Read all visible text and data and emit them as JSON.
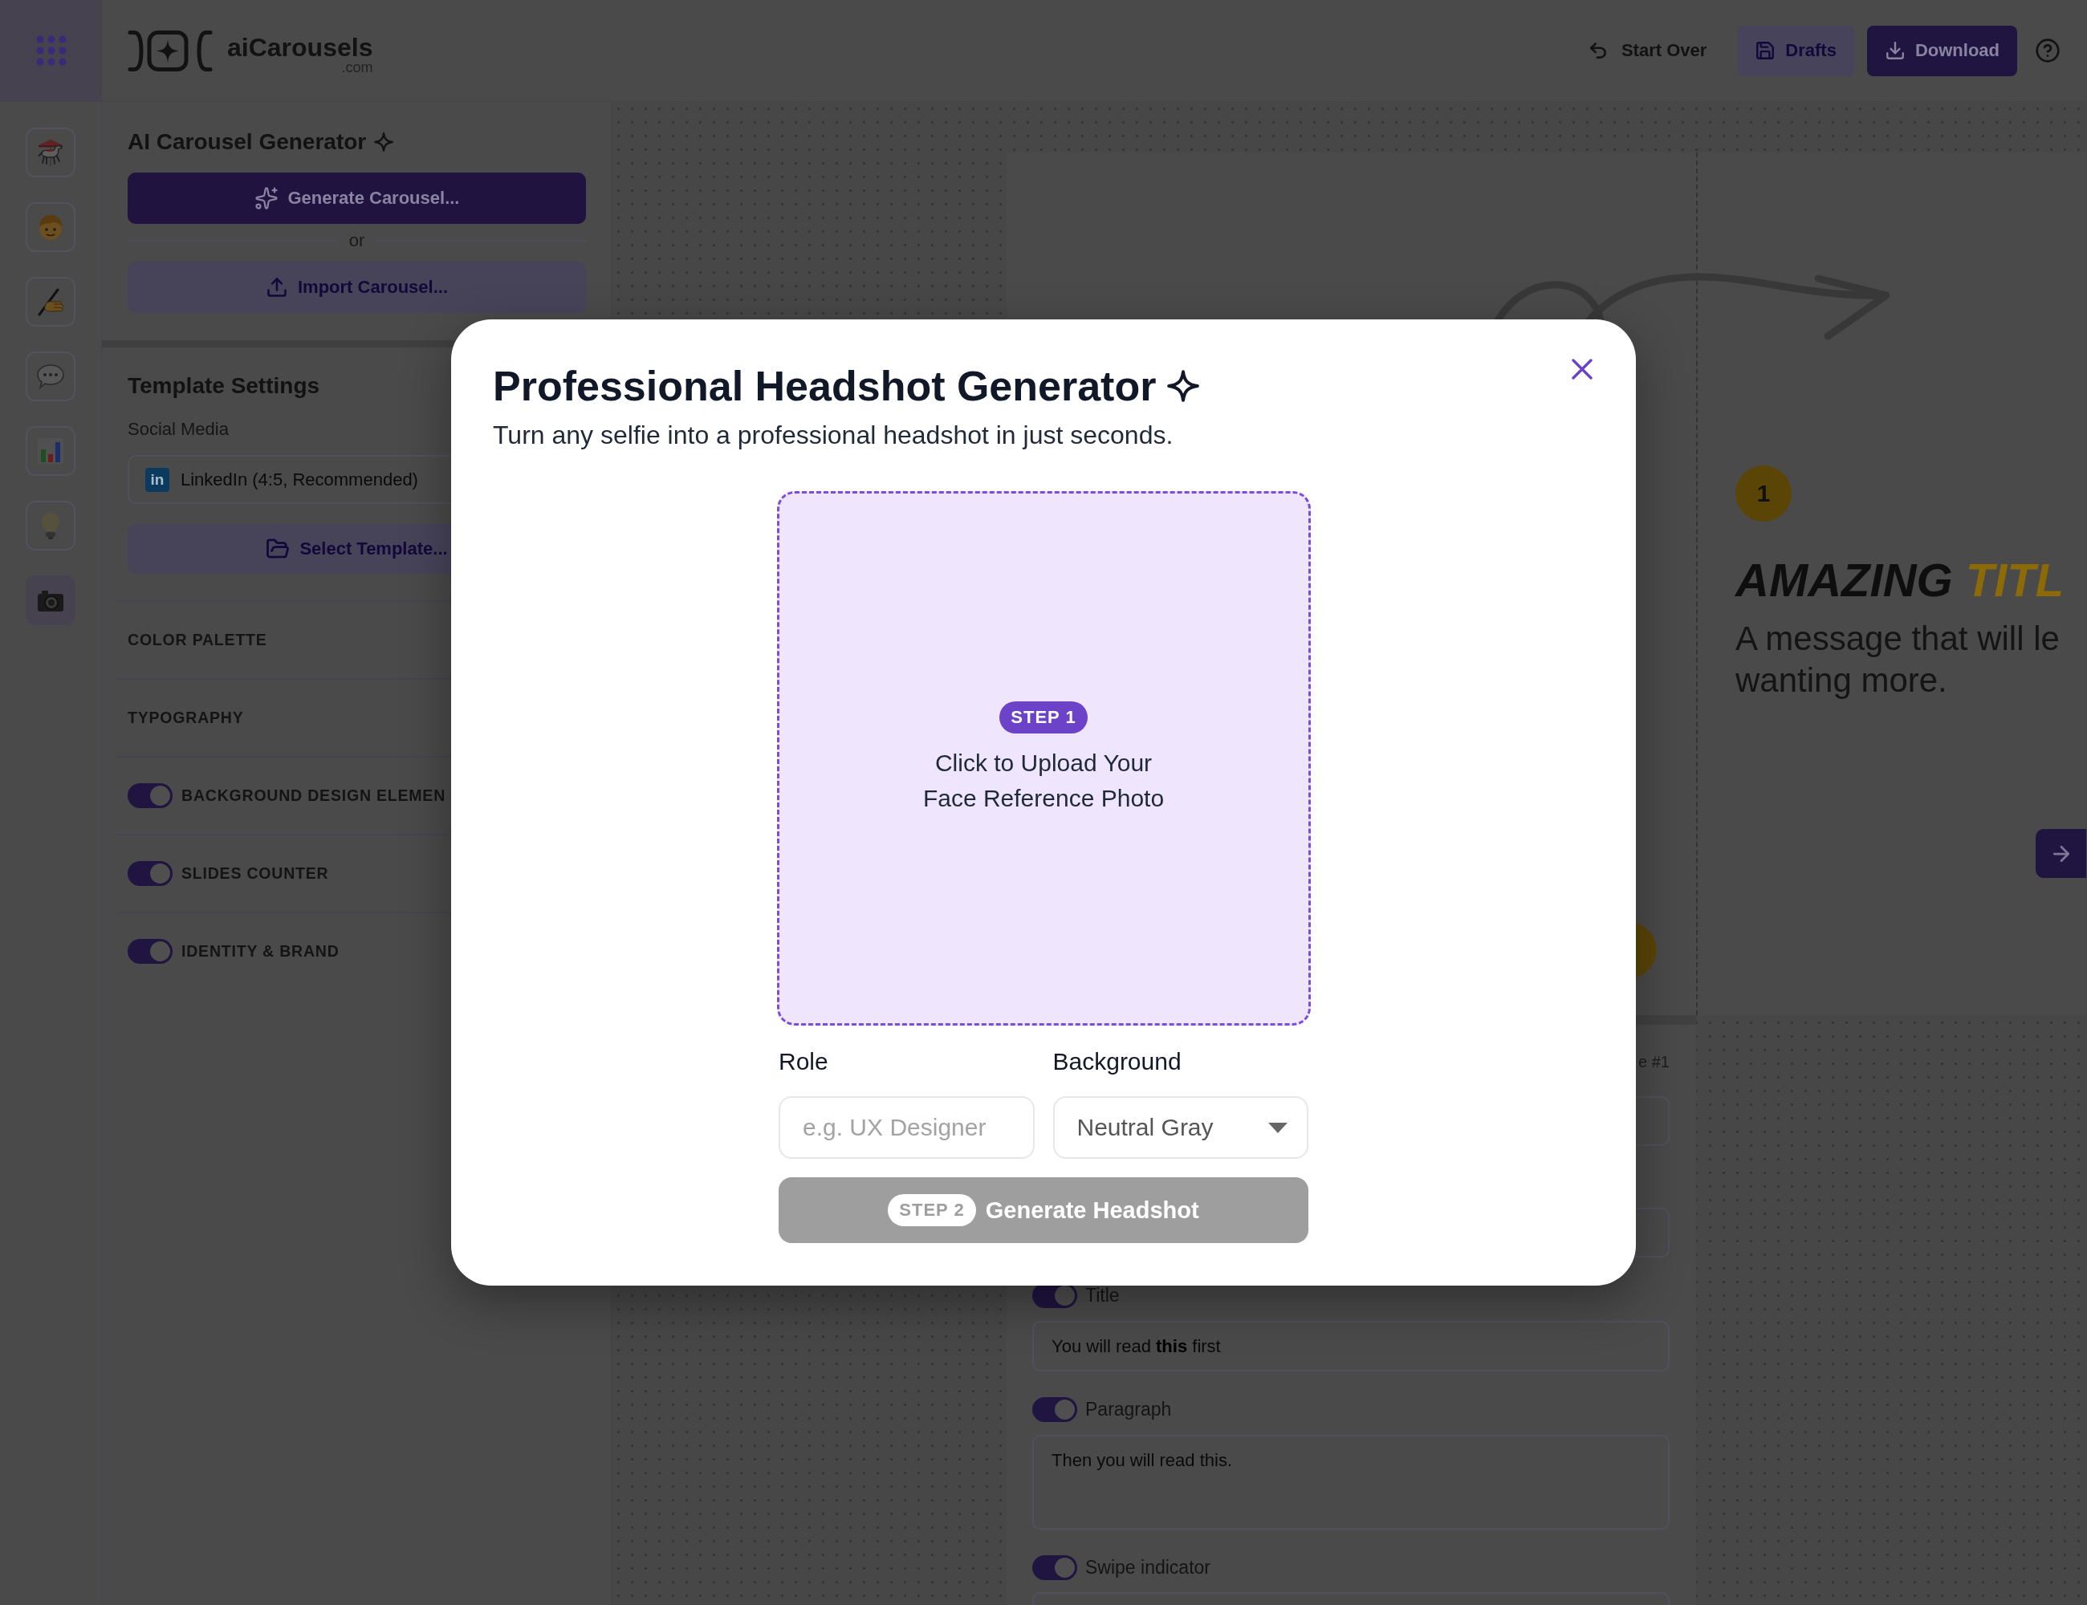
{
  "header": {
    "logo": {
      "name": "aiCarousels",
      "suffix": ".com"
    },
    "actions": [
      {
        "kind": "text",
        "label": "Start Over"
      },
      {
        "kind": "secondary",
        "label": "Drafts"
      },
      {
        "kind": "primary",
        "label": "Download"
      },
      {
        "kind": "icon"
      }
    ]
  },
  "rail": {
    "items": [
      {
        "selected": false
      },
      {
        "selected": false
      },
      {
        "selected": false
      },
      {
        "selected": false
      },
      {
        "selected": false
      },
      {
        "selected": false
      },
      {
        "selected": true
      }
    ]
  },
  "generator": {
    "title": "AI Carousel Generator",
    "generate_button": "Generate Carousel...",
    "divider": "or",
    "import_button": "Import Carousel..."
  },
  "template_settings": {
    "title": "Template Settings",
    "platform_label": "Social Media",
    "platform": {
      "logo": "in",
      "value": "LinkedIn (4:5, Recommended)"
    },
    "select_button": "Select Template...",
    "sections": [
      {
        "kind": "heading",
        "label": "COLOR PALETTE"
      },
      {
        "kind": "heading",
        "label": "TYPOGRAPHY"
      },
      {
        "kind": "toggle",
        "label": "BACKGROUND DESIGN ELEMEN",
        "on": true
      },
      {
        "kind": "toggle",
        "label": "SLIDES COUNTER",
        "on": true
      },
      {
        "kind": "toggle",
        "label": "IDENTITY & BRAND",
        "on": true
      }
    ]
  },
  "slide": {
    "number": "1",
    "title": "AMAZING",
    "title_highlight": "TITL",
    "text_lines": [
      "A message that will le",
      "wanting more."
    ]
  },
  "editor": {
    "rows": [
      {
        "kind": "caption",
        "text": "e #1"
      },
      {
        "kind": "field_edge"
      },
      {
        "kind": "field_edge"
      },
      {
        "kind": "toggle",
        "label": "Title",
        "on": true
      },
      {
        "kind": "field",
        "value": "You will read **this** first"
      },
      {
        "kind": "toggle",
        "label": "Paragraph",
        "on": true
      },
      {
        "kind": "textarea",
        "value": "Then you will read this."
      },
      {
        "kind": "toggle",
        "label": "Swipe indicator",
        "on": true
      },
      {
        "kind": "field"
      }
    ]
  },
  "modal": {
    "title": "Professional Headshot Generator",
    "subtitle": "Turn any selfie into a professional headshot in just seconds.",
    "upload": {
      "step": "STEP 1",
      "lines": [
        "Click to Upload Your",
        "Face Reference Photo"
      ]
    },
    "role": {
      "label": "Role",
      "placeholder": "e.g. UX Designer"
    },
    "background": {
      "label": "Background",
      "value": "Neutral Gray"
    },
    "generate": {
      "step": "STEP 2",
      "label": "Generate Headshot",
      "disabled": true
    }
  }
}
